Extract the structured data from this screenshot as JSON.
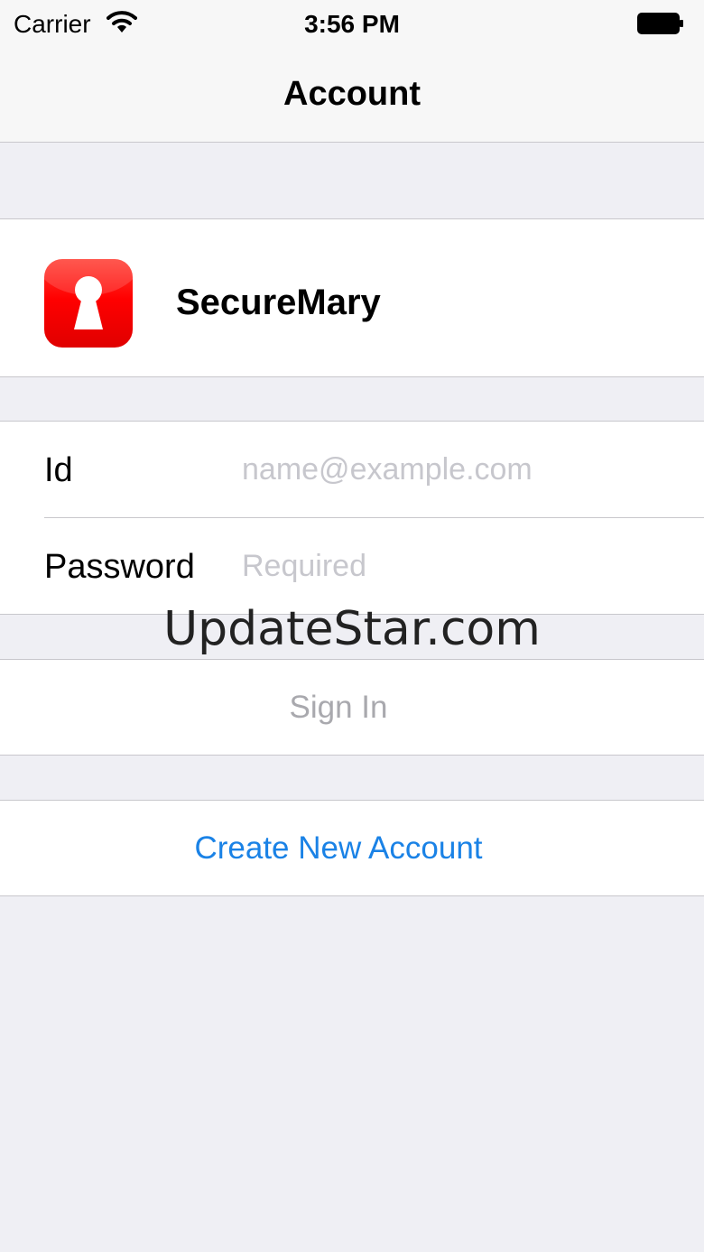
{
  "status_bar": {
    "carrier": "Carrier",
    "wifi_icon": "wifi-icon",
    "time": "3:56 PM",
    "battery_icon": "battery-icon"
  },
  "nav": {
    "title": "Account"
  },
  "app": {
    "name": "SecureMary",
    "icon": "keyhole-icon",
    "icon_color": "#ff0000"
  },
  "form": {
    "id_label": "Id",
    "id_placeholder": "name@example.com",
    "id_value": "",
    "password_label": "Password",
    "password_placeholder": "Required",
    "password_value": ""
  },
  "actions": {
    "sign_in_label": "Sign In",
    "create_account_label": "Create New Account"
  },
  "watermark": "UpdateStar.com",
  "colors": {
    "background": "#efeff4",
    "link_blue": "#1a82e6",
    "disabled_gray": "#a9a9ae",
    "placeholder_gray": "#c7c7cd"
  }
}
